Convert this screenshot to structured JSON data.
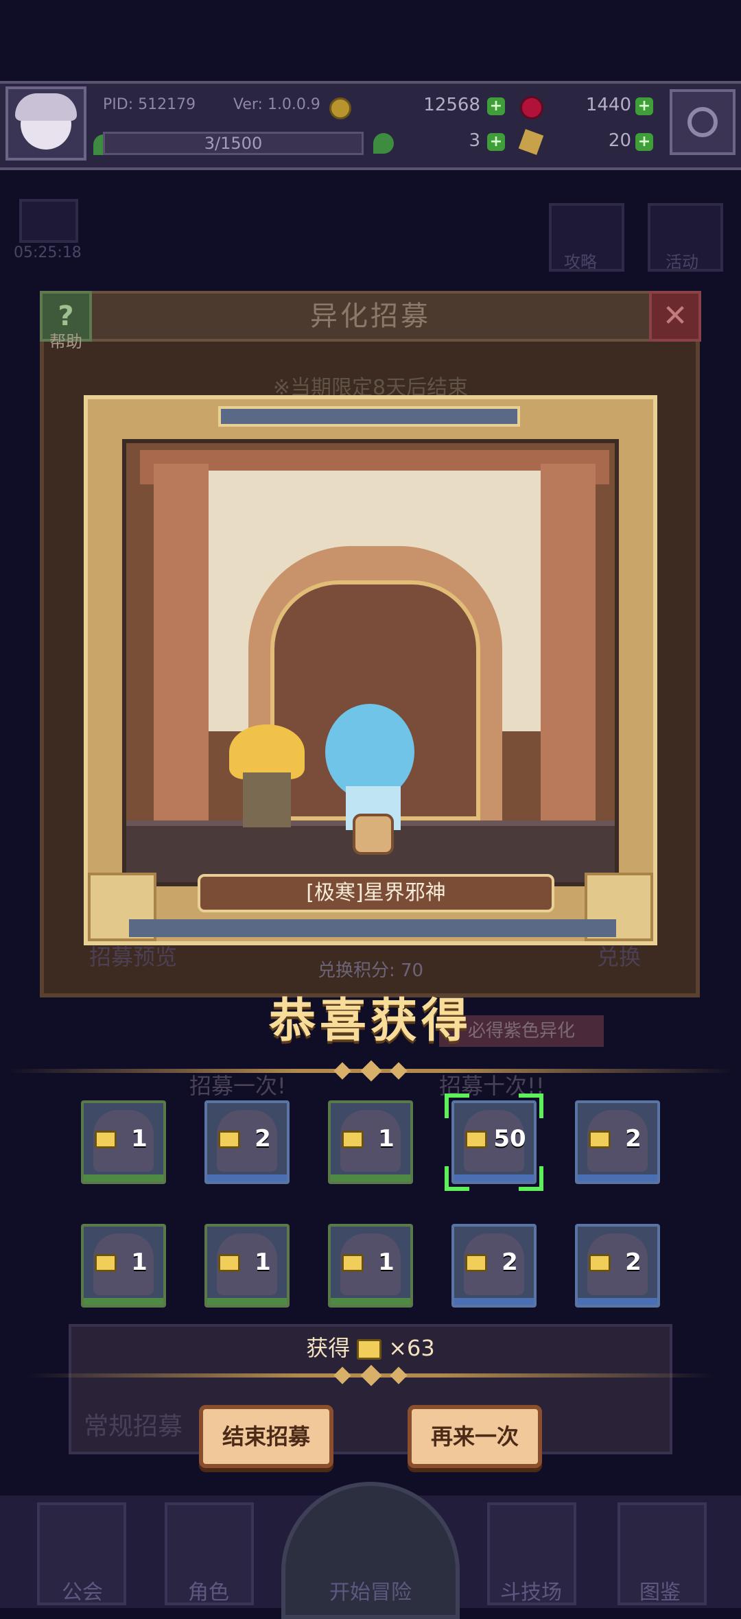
{
  "top_bar": {
    "pid": "PID: 512179",
    "version": "Ver: 1.0.0.9",
    "gold": "12568",
    "gems": "1440",
    "stamina": "3/1500",
    "clover": "3",
    "keys": "20"
  },
  "background": {
    "timer": "05:25:18",
    "strategy_label": "攻略",
    "activity_label": "活动",
    "help_label": "帮助",
    "dialog_title": "异化招募",
    "limited_notice": "※当期限定8天后结束",
    "recruit_preview": "招募预览",
    "exchange": "兑换",
    "points": "兑换积分: 70",
    "guarantee_badge": "必得紫色异化",
    "recruit_once": "招募一次!",
    "recruit_ten": "招募十次!!",
    "normal_recruit": "常规招募"
  },
  "card": {
    "character_name": "[极寒]星界邪神"
  },
  "result": {
    "congrats_title": "恭喜获得",
    "items": [
      {
        "count": "1",
        "rarity": "green",
        "selected": false
      },
      {
        "count": "2",
        "rarity": "blue",
        "selected": false
      },
      {
        "count": "1",
        "rarity": "green",
        "selected": false
      },
      {
        "count": "50",
        "rarity": "blue",
        "selected": true
      },
      {
        "count": "2",
        "rarity": "blue",
        "selected": false
      },
      {
        "count": "1",
        "rarity": "green",
        "selected": false
      },
      {
        "count": "1",
        "rarity": "green",
        "selected": false
      },
      {
        "count": "1",
        "rarity": "green",
        "selected": false
      },
      {
        "count": "2",
        "rarity": "blue",
        "selected": false
      },
      {
        "count": "2",
        "rarity": "blue",
        "selected": false
      }
    ],
    "obtained_label": "获得",
    "obtained_count": "×63",
    "end_button": "结束招募",
    "again_button": "再来一次"
  },
  "bottom_nav": {
    "guild": "公会",
    "characters": "角色",
    "start_adventure": "开始冒险",
    "arena": "斗技场",
    "codex": "图鉴"
  },
  "colors": {
    "background": "#0f0e26",
    "gold_text": "#f7dc9a",
    "selection_green": "#5ef05a",
    "button_fill": "#f0c89a"
  },
  "icons": [
    "avatar",
    "coin-icon",
    "gem-icon",
    "plus-icon",
    "clover-icon",
    "key-icon",
    "settings-gear-icon",
    "help-icon",
    "close-icon",
    "ticket-icon",
    "medal-icon"
  ]
}
